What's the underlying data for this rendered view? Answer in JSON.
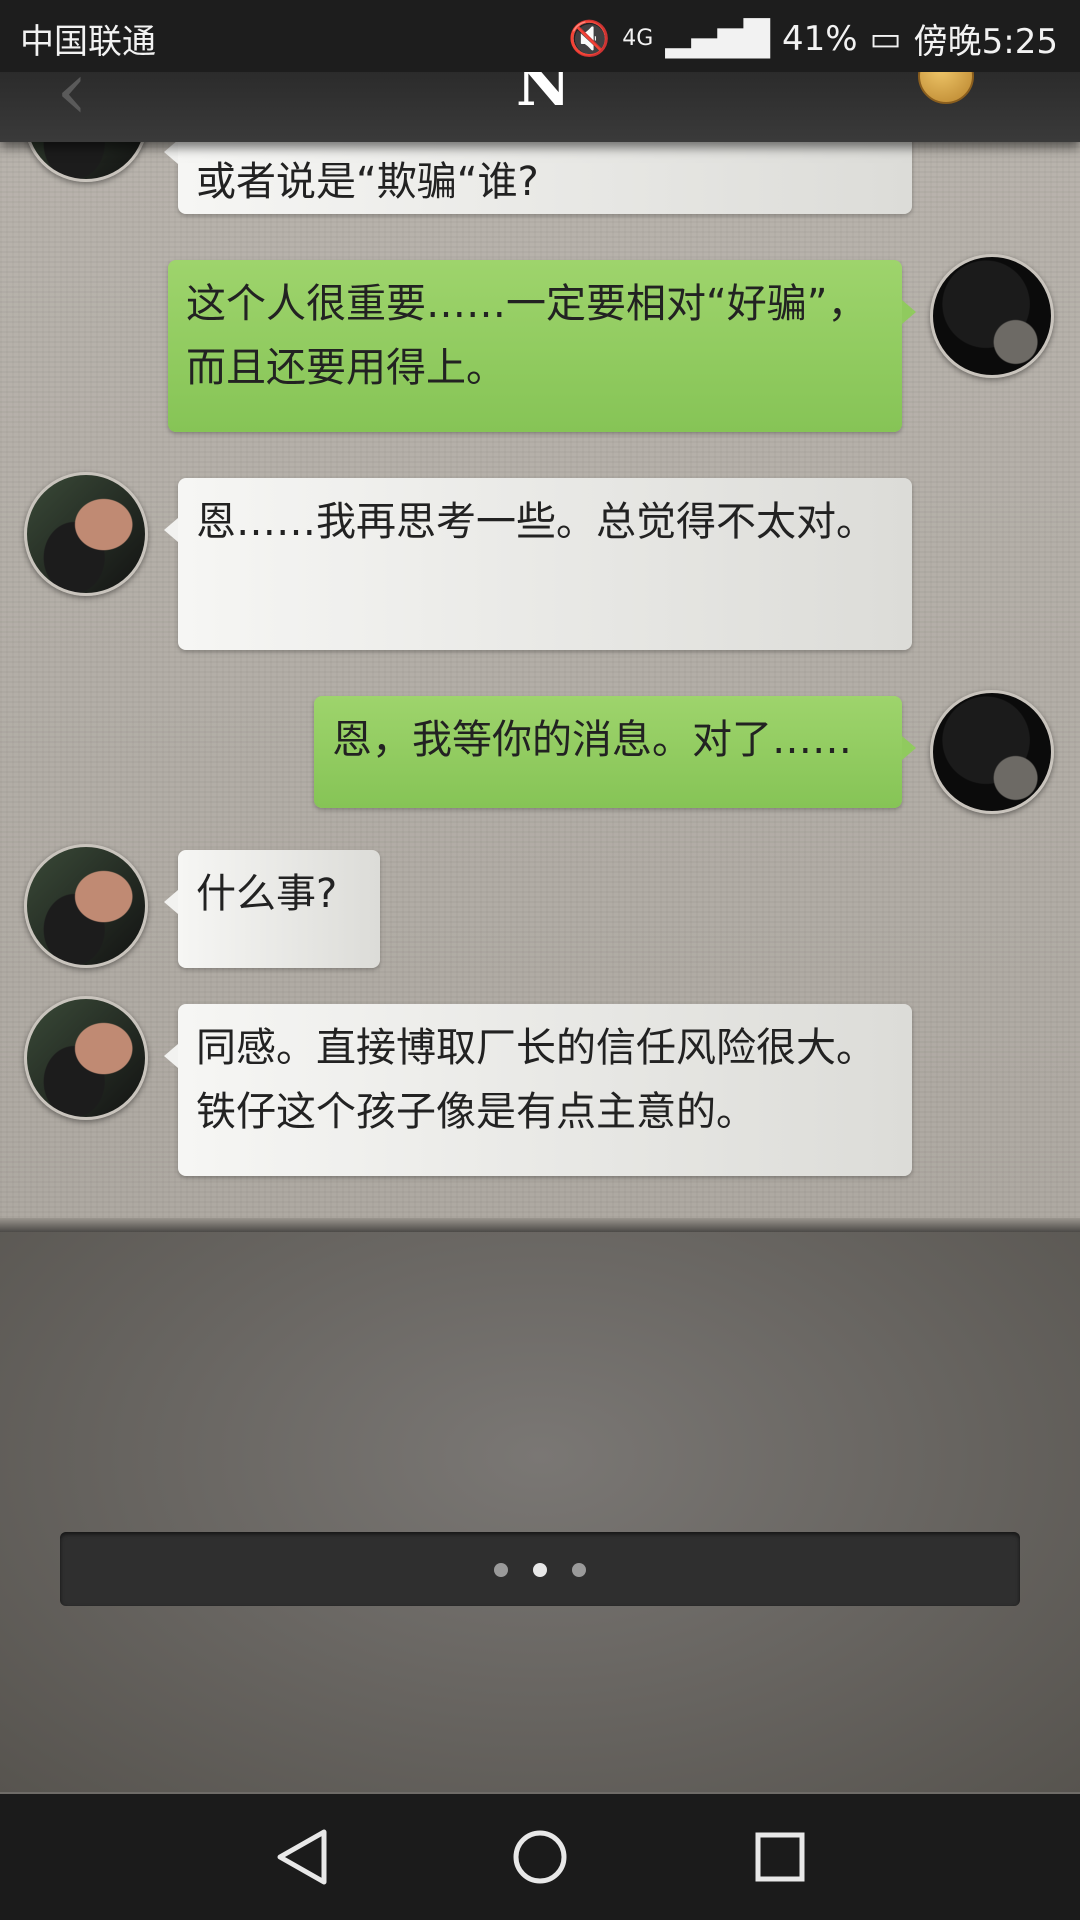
{
  "status_bar": {
    "carrier": "中国联通",
    "network": "4G",
    "battery": "41%",
    "time": "傍晚5:25"
  },
  "top_nav": {
    "logo": "N"
  },
  "messages": [
    {
      "side": "in",
      "text": "或者说是“欺骗“谁?"
    },
    {
      "side": "out",
      "text": "这个人很重要……一定要相对“好骗”，而且还要用得上。"
    },
    {
      "side": "in",
      "text": "恩……我再思考一些。总觉得不太对。"
    },
    {
      "side": "out",
      "text": "恩，我等你的消息。对了……"
    },
    {
      "side": "in",
      "text": "什么事?"
    },
    {
      "side": "in",
      "text": "同感。直接博取厂长的信任风险很大。铁仔这个孩子像是有点主意的。"
    }
  ],
  "pager": {
    "count": 3,
    "active": 2
  },
  "icons": [
    "back-icon",
    "mute-icon",
    "signal-icon",
    "battery-icon",
    "home-icon",
    "recents-icon"
  ],
  "colors": {
    "outgoing_bubble": "#8fcb5f",
    "incoming_bubble": "#ededeb",
    "status_bar": "#1d1d1d"
  }
}
